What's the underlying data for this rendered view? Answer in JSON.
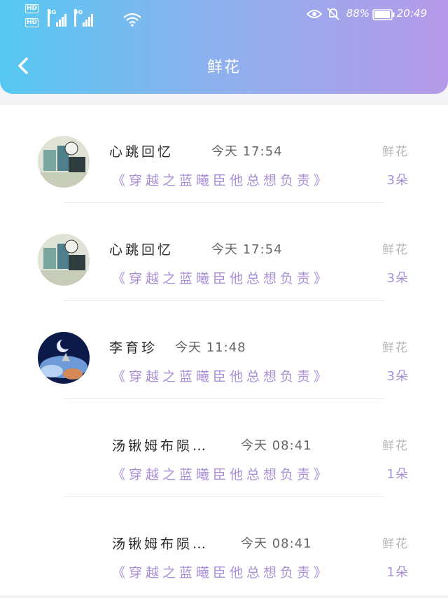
{
  "status_bar": {
    "left_badges": [
      "HD",
      "HD"
    ],
    "network_labels": [
      "4G",
      "4G"
    ],
    "battery": "88%",
    "time": "20:49",
    "icons": [
      "eye-icon",
      "mute-bell-icon",
      "battery-icon",
      "wifi-icon"
    ]
  },
  "header": {
    "title": "鲜花",
    "back_icon": "chevron-left-icon"
  },
  "list": {
    "items": [
      {
        "name": "心跳回忆",
        "time": "今天 17:54",
        "gift": "鲜花",
        "book": "《穿越之蓝曦臣他总想负责》",
        "count": "3朵",
        "avatar": "cartoon"
      },
      {
        "name": "心跳回忆",
        "time": "今天 17:54",
        "gift": "鲜花",
        "book": "《穿越之蓝曦臣他总想负责》",
        "count": "3朵",
        "avatar": "cartoon"
      },
      {
        "name": "李育珍",
        "time": "今天 11:48",
        "gift": "鲜花",
        "book": "《穿越之蓝曦臣他总想负责》",
        "count": "3朵",
        "avatar": "night"
      },
      {
        "name": "汤锹姆布陨…",
        "time": "今天 08:41",
        "gift": "鲜花",
        "book": "《穿越之蓝曦臣他总想负责》",
        "count": "1朵",
        "avatar": "none"
      },
      {
        "name": "汤锹姆布陨…",
        "time": "今天 08:41",
        "gift": "鲜花",
        "book": "《穿越之蓝曦臣他总想负责》",
        "count": "1朵",
        "avatar": "none"
      }
    ]
  }
}
